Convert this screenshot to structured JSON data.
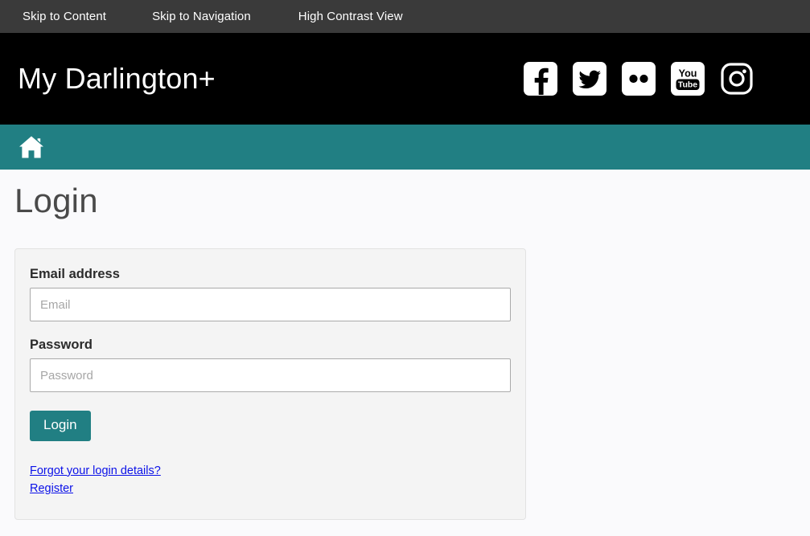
{
  "accessibility_bar": {
    "skip_to_content": "Skip to Content",
    "skip_to_navigation": "Skip to Navigation",
    "high_contrast": "High Contrast View"
  },
  "masthead": {
    "brand": "My Darlington+",
    "social": [
      {
        "name": "facebook-icon",
        "label": "Facebook"
      },
      {
        "name": "twitter-icon",
        "label": "Twitter"
      },
      {
        "name": "flickr-icon",
        "label": "Flickr"
      },
      {
        "name": "youtube-icon",
        "label": "YouTube",
        "text_top": "You",
        "text_bottom": "Tube"
      },
      {
        "name": "instagram-icon",
        "label": "Instagram"
      }
    ]
  },
  "navbar": {
    "home_label": "Home",
    "background_color": "#217f83"
  },
  "main": {
    "page_title": "Login",
    "form": {
      "email_label": "Email address",
      "email_placeholder": "Email",
      "email_value": "",
      "password_label": "Password",
      "password_placeholder": "Password",
      "password_value": "",
      "submit_label": "Login"
    },
    "links": {
      "forgot": "Forgot your login details?",
      "register": "Register"
    }
  },
  "colors": {
    "accent_teal": "#217f83",
    "top_bar": "#3a3a3a",
    "masthead": "#000000",
    "page_background": "#fafafc",
    "panel_background": "#f4f4f4",
    "link_blue": "#0b11e8"
  }
}
